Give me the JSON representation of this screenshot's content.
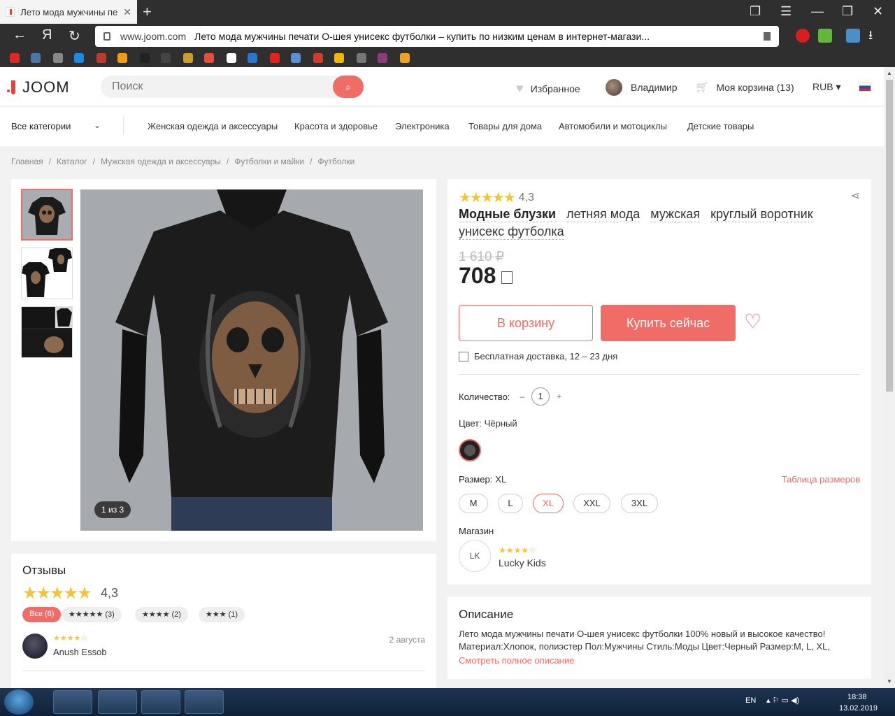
{
  "browser": {
    "tab_title": "Лето мода мужчины пе",
    "url_domain": "www.joom.com",
    "url_title": "Лето мода мужчины печати О-шея унисекс футболки – купить по низким ценам в интернет-магази...",
    "back_glyph": "←",
    "yandex_glyph": "Я",
    "reload_glyph": "↻"
  },
  "header": {
    "logo": "JOOM",
    "search_placeholder": "Поиск",
    "favorites": "Избранное",
    "user_name": "Владимир",
    "cart": "Моя корзина (13)",
    "currency": "RUB ▾"
  },
  "categories": {
    "all": "Все категории",
    "links": [
      "Женская одежда и аксессуары",
      "Красота и здоровье",
      "Электроника",
      "Товары для дома",
      "Автомобили и мотоциклы",
      "Детские товары"
    ]
  },
  "breadcrumbs": [
    "Главная",
    "/",
    "Каталог",
    "/",
    "Мужская одежда и аксессуары",
    "/",
    "Футболки и майки",
    "/",
    "Футболки"
  ],
  "gallery": {
    "counter": "1 из 3"
  },
  "product": {
    "rating_stars": "★★★★★",
    "rating": "4,3",
    "title_words": [
      "Модные блузки",
      "летняя мода",
      "мужская",
      "круглый воротник",
      "унисекс футболка"
    ],
    "old_price": "1 610 ₽",
    "price": "708",
    "btn_cart": "В корзину",
    "btn_buy": "Купить сейчас",
    "delivery": "Бесплатная доставка, 12 – 23 дня",
    "qty_label": "Количество:",
    "qty_minus": "–",
    "qty_value": "1",
    "qty_plus": "+",
    "color_label": "Цвет:",
    "color_value": "Чёрный",
    "size_label": "Размер:",
    "size_value": "XL",
    "size_chart": "Таблица размеров",
    "sizes": [
      "M",
      "L",
      "XL",
      "XXL",
      "3XL"
    ],
    "shop_label": "Магазин",
    "shop_initials": "LK",
    "shop_stars": "★★★★☆",
    "shop_name": "Lucky Kids"
  },
  "reviews": {
    "title": "Отзывы",
    "stars": "★★★★★",
    "score": "4,3",
    "chips": [
      "Все (6)",
      "★★★★★ (3)",
      "★★★★ (2)",
      "★★★ (1)"
    ],
    "reviewer_stars": "★★★★☆",
    "reviewer": "Anush Essob",
    "date": "2 августа"
  },
  "description": {
    "title": "Описание",
    "line1": "Лето мода мужчины печати О-шея унисекс футболки  100% новый и высокое качество!",
    "line2": "Материал:Хлопок, полиэстер  Пол:Мужчины  Стиль:Моды  Цвет:Черный  Размер:M, L, XL,",
    "more": "Смотреть полное описание"
  },
  "taskbar": {
    "lang": "EN",
    "time": "18:38",
    "date": "13.02.2019"
  },
  "colors": {
    "accent": "#ef6d66",
    "star": "#f2c43d"
  }
}
